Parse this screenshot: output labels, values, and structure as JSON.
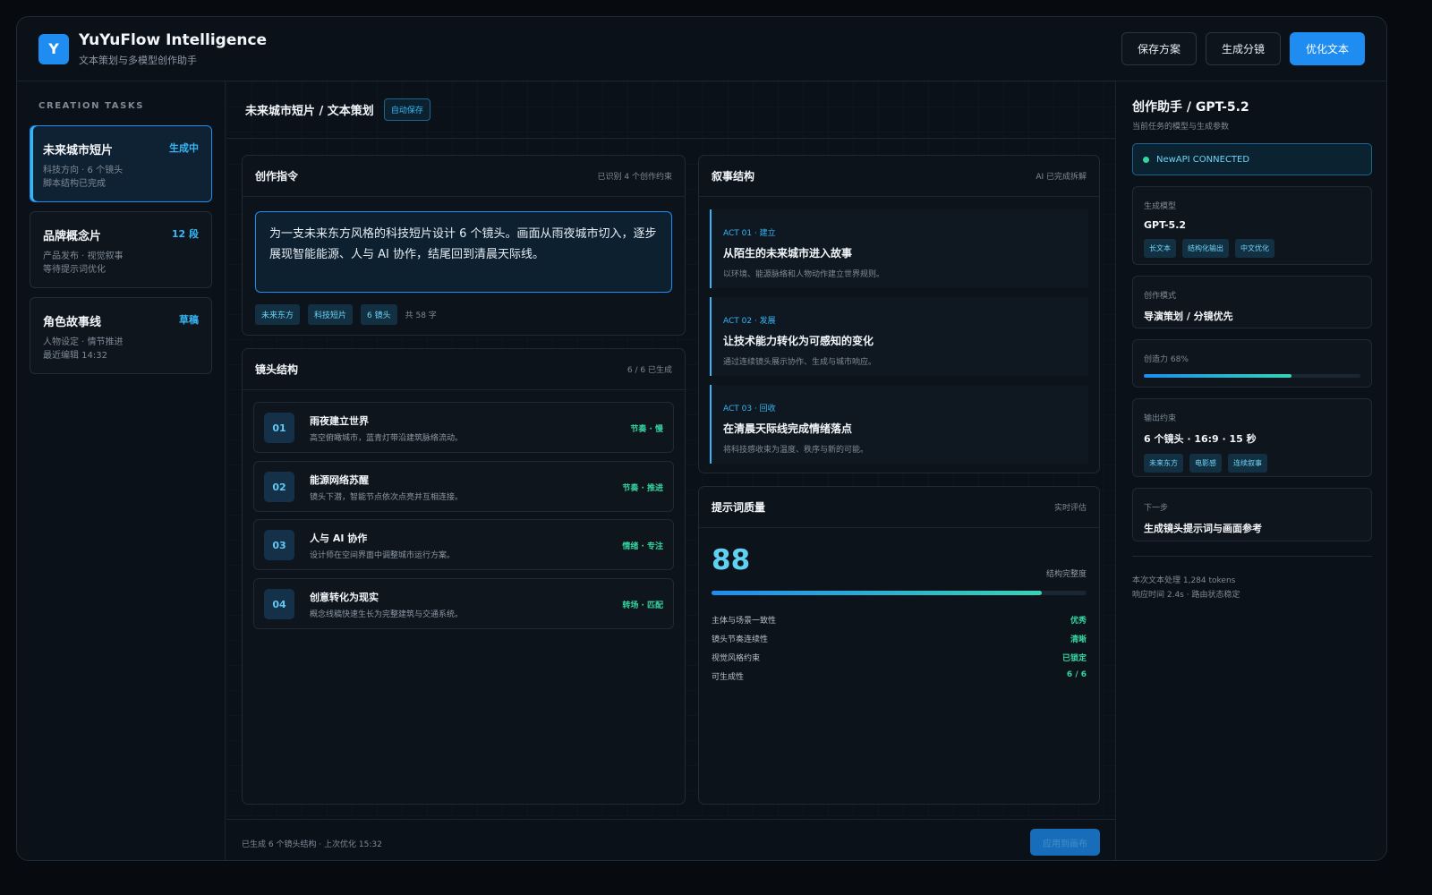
{
  "header": {
    "logo_letter": "Y",
    "title": "YuYuFlow Intelligence",
    "subtitle": "文本策划与多模型创作助手",
    "actions": {
      "save": "保存方案",
      "storyboard": "生成分镜",
      "optimize": "优化文本"
    }
  },
  "sidebar": {
    "title": "CREATION TASKS",
    "tasks": [
      {
        "name": "未来城市短片",
        "status": "生成中",
        "meta1": "科技方向 · 6 个镜头",
        "meta2": "脚本结构已完成"
      },
      {
        "name": "品牌概念片",
        "status": "12 段",
        "meta1": "产品发布 · 视觉叙事",
        "meta2": "等待提示词优化"
      },
      {
        "name": "角色故事线",
        "status": "草稿",
        "meta1": "人物设定 · 情节推进",
        "meta2": "最近编辑 14:32"
      }
    ]
  },
  "center": {
    "title": "未来城市短片 / 文本策划",
    "autosave": "自动保存",
    "instruction": {
      "title": "创作指令",
      "aside": "已识别 4 个创作约束",
      "text": "为一支未来东方风格的科技短片设计 6 个镜头。画面从雨夜城市切入，逐步展现智能能源、人与 AI 协作，结尾回到清晨天际线。",
      "chips": [
        "未来东方",
        "科技短片",
        "6 镜头"
      ],
      "count": "共 58 字"
    },
    "shots": {
      "title": "镜头结构",
      "aside": "6 / 6 已生成",
      "items": [
        {
          "no": "01",
          "title": "雨夜建立世界",
          "desc": "高空俯瞰城市，蓝青灯带沿建筑脉络流动。",
          "tag": "节奏 · 慢"
        },
        {
          "no": "02",
          "title": "能源网络苏醒",
          "desc": "镜头下潜，智能节点依次点亮并互相连接。",
          "tag": "节奏 · 推进"
        },
        {
          "no": "03",
          "title": "人与 AI 协作",
          "desc": "设计师在空间界面中调整城市运行方案。",
          "tag": "情绪 · 专注"
        },
        {
          "no": "04",
          "title": "创意转化为现实",
          "desc": "概念线稿快速生长为完整建筑与交通系统。",
          "tag": "转场 · 匹配"
        }
      ]
    },
    "narrative": {
      "title": "叙事结构",
      "aside": "AI 已完成拆解",
      "acts": [
        {
          "label": "ACT 01 · 建立",
          "title": "从陌生的未来城市进入故事",
          "desc": "以环境、能源脉络和人物动作建立世界规则。"
        },
        {
          "label": "ACT 02 · 发展",
          "title": "让技术能力转化为可感知的变化",
          "desc": "通过连续镜头展示协作、生成与城市响应。"
        },
        {
          "label": "ACT 03 · 回收",
          "title": "在清晨天际线完成情绪落点",
          "desc": "将科技感收束为温度、秩序与新的可能。"
        }
      ]
    },
    "quality": {
      "title": "提示词质量",
      "aside": "实时评估",
      "score": "88",
      "score_label": "结构完整度",
      "score_fraction": 0.88,
      "metrics": [
        {
          "name": "主体与场景一致性",
          "value": "优秀"
        },
        {
          "name": "镜头节奏连续性",
          "value": "清晰"
        },
        {
          "name": "视觉风格约束",
          "value": "已锁定"
        },
        {
          "name": "可生成性",
          "value": "6 / 6"
        }
      ]
    },
    "footer": {
      "text": "已生成 6 个镜头结构 · 上次优化 15:32",
      "apply": "应用到画布"
    }
  },
  "assistant": {
    "title": "创作助手 / GPT-5.2",
    "subtitle": "当前任务的模型与生成参数",
    "connection": "NewAPI CONNECTED",
    "model": {
      "label": "生成模型",
      "value": "GPT-5.2",
      "chips": [
        "长文本",
        "结构化输出",
        "中文优化"
      ]
    },
    "mode": {
      "label": "创作模式",
      "value": "导演策划 / 分镜优先"
    },
    "creativity": {
      "label": "创造力 68%",
      "fraction": 0.68
    },
    "output": {
      "label": "输出约束",
      "value": "6 个镜头 · 16:9 · 15 秒",
      "chips": [
        "未来东方",
        "电影感",
        "连续叙事"
      ]
    },
    "next": {
      "label": "下一步",
      "value": "生成镜头提示词与画面参考"
    },
    "stats": [
      "本次文本处理 1,284 tokens",
      "响应时间 2.4s · 路由状态稳定"
    ]
  },
  "colors": {
    "accent": "#1e8cf0",
    "cyan": "#35b6f5",
    "success": "#35d4a0",
    "background": "#0b1118"
  }
}
